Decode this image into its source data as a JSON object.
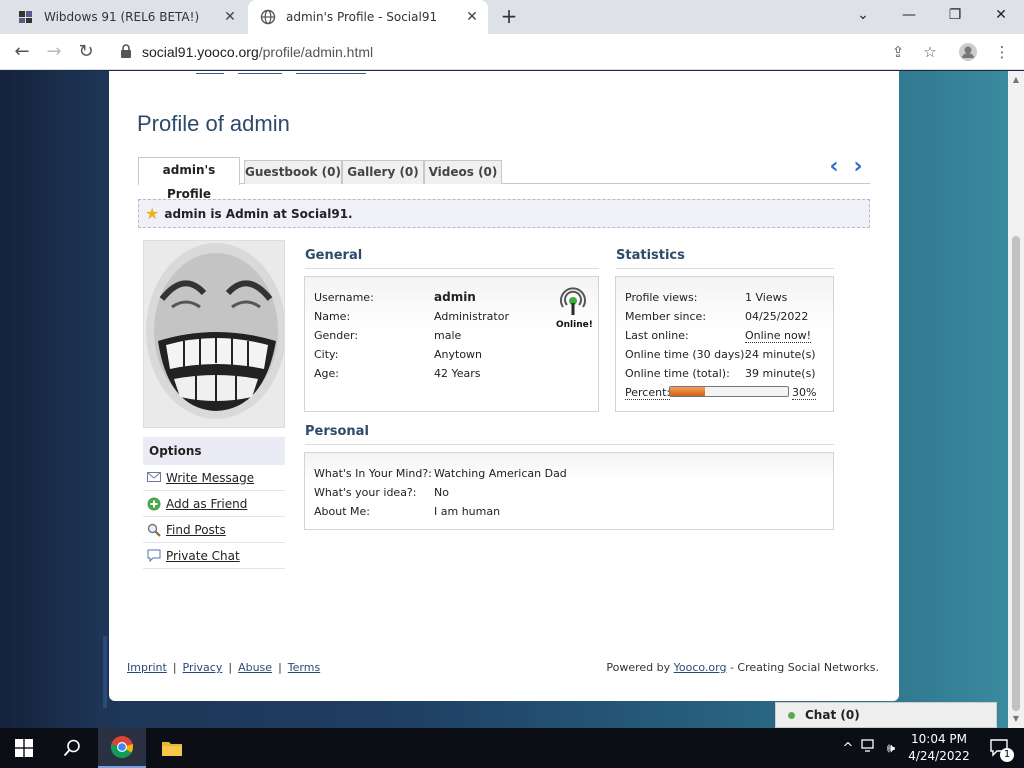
{
  "browser": {
    "tabs": [
      {
        "title": "Wibdows 91 (REL6 BETA!)",
        "active": false
      },
      {
        "title": "admin's Profile - Social91",
        "active": true
      }
    ],
    "url_host": "social91.yooco.org",
    "url_path": "/profile/admin.html"
  },
  "page": {
    "title": "Profile of admin",
    "tabs": [
      "admin's Profile",
      "Guestbook (0)",
      "Gallery (0)",
      "Videos (0)"
    ],
    "notice": "admin is Admin at Social91.",
    "general": {
      "title": "General",
      "online_label": "Online!",
      "rows": [
        {
          "key": "Username:",
          "value": "admin"
        },
        {
          "key": "Name:",
          "value": "Administrator"
        },
        {
          "key": "Gender:",
          "value": "male"
        },
        {
          "key": "City:",
          "value": "Anytown"
        },
        {
          "key": "Age:",
          "value": "42 Years"
        }
      ]
    },
    "statistics": {
      "title": "Statistics",
      "rows": [
        {
          "key": "Profile views:",
          "value": "1 Views"
        },
        {
          "key": "Member since:",
          "value": "04/25/2022"
        },
        {
          "key": "Last online:",
          "value": "Online now!"
        },
        {
          "key": "Online time (30 days):",
          "value": "24 minute(s)"
        },
        {
          "key": "Online time (total):",
          "value": "39 minute(s)"
        }
      ],
      "percent_label": "Percent:",
      "percent_text": "30%",
      "percent_value": 0.3
    },
    "personal": {
      "title": "Personal",
      "rows": [
        {
          "key": "What's In Your Mind?:",
          "value": "Watching American Dad"
        },
        {
          "key": "What's your idea?:",
          "value": "No"
        },
        {
          "key": "About Me:",
          "value": "I am human"
        }
      ]
    },
    "options": {
      "title": "Options",
      "items": [
        "Write Message",
        "Add as Friend",
        "Find Posts",
        "Private Chat"
      ]
    },
    "footer": {
      "links": [
        "Imprint",
        "Privacy",
        "Abuse",
        "Terms"
      ],
      "powered_prefix": "Powered by",
      "powered_link": "Yooco.org",
      "powered_suffix": "- Creating Social Networks."
    }
  },
  "chat": {
    "label": "Chat (0)"
  },
  "taskbar": {
    "time": "10:04 PM",
    "date": "4/24/2022",
    "notification_count": "1"
  },
  "colors": {
    "accent_blue": "#2e4a6a",
    "progress_orange": "#d2601a",
    "online_green": "#5ca84c"
  }
}
